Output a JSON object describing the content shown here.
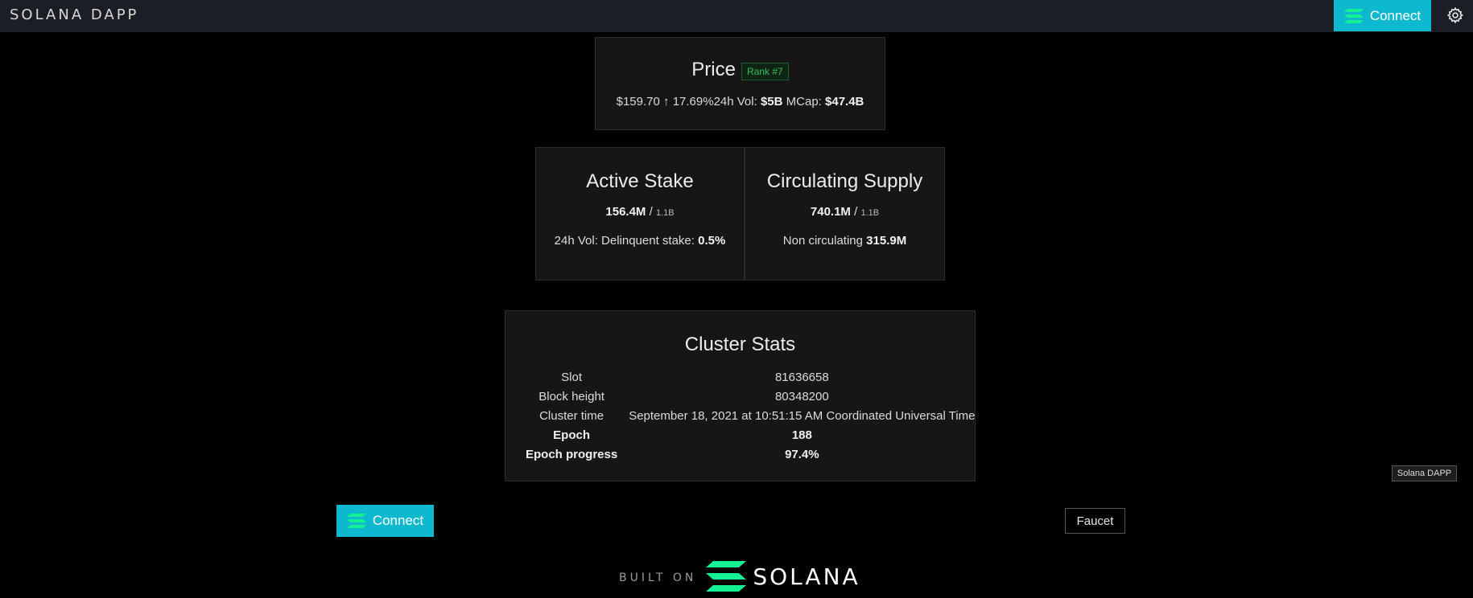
{
  "header": {
    "brand": "SOLANA DAPP",
    "connect_label": "Connect"
  },
  "price": {
    "title": "Price",
    "rank": "Rank #7",
    "value": "$159.70",
    "change_arrow": "↑",
    "change": "17.69%",
    "vol_label": "24h Vol:",
    "vol_value": "$5B",
    "mcap_label": "MCap:",
    "mcap_value": "$47.4B"
  },
  "stake": {
    "title": "Active Stake",
    "amount": "156.4M",
    "separator": "/",
    "total": "1.1B",
    "sub_label": "24h Vol: Delinquent stake:",
    "sub_value": "0.5%"
  },
  "supply": {
    "title": "Circulating Supply",
    "amount": "740.1M",
    "separator": "/",
    "total": "1.1B",
    "sub_label": "Non circulating",
    "sub_value": "315.9M"
  },
  "cluster": {
    "title": "Cluster Stats",
    "rows": [
      {
        "label": "Slot",
        "value": "81636658"
      },
      {
        "label": "Block height",
        "value": "80348200"
      },
      {
        "label": "Cluster time",
        "value": "September 18, 2021 at 10:51:15 AM Coordinated Universal Time"
      },
      {
        "label": "Epoch",
        "value": "188"
      },
      {
        "label": "Epoch progress",
        "value": "97.4%"
      }
    ]
  },
  "tooltip": "Solana DAPP",
  "bottom": {
    "connect_label": "Connect",
    "faucet_label": "Faucet"
  },
  "footer": {
    "built_on": "BUILT ON",
    "solana_word": "SOLANA"
  },
  "colors": {
    "accent": "#0eb9cf",
    "rank_green": "#36c05a",
    "logo_green": "#14f195"
  }
}
